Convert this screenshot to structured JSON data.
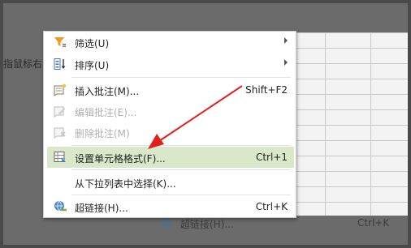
{
  "background": {
    "hint_text": "指鼠标右",
    "ghost_row": {
      "label": "超链接(H)...",
      "shortcut": "Ctrl+K"
    }
  },
  "context_menu": {
    "items": [
      {
        "label": "筛选(U)",
        "icon": "filter-icon",
        "submenu": true,
        "state": "normal"
      },
      {
        "label": "排序(U)",
        "icon": "sort-icon",
        "submenu": true,
        "state": "normal"
      },
      {
        "label": "插入批注(M)...",
        "shortcut": "Shift+F2",
        "icon": "insert-comment-icon",
        "state": "normal"
      },
      {
        "label": "编辑批注(E)...",
        "icon": "edit-comment-icon",
        "state": "disabled"
      },
      {
        "label": "删除批注(M)",
        "icon": "delete-comment-icon",
        "state": "disabled"
      },
      {
        "label": "设置单元格格式(F)...",
        "shortcut": "Ctrl+1",
        "icon": "format-cells-icon",
        "state": "highlighted"
      },
      {
        "label": "从下拉列表中选择(K)...",
        "state": "normal"
      },
      {
        "label": "超链接(H)...",
        "shortcut": "Ctrl+K",
        "icon": "hyperlink-icon",
        "state": "normal"
      }
    ]
  },
  "annotation": {
    "arrow_color": "#e02020"
  },
  "colors": {
    "highlight": "#d8e8c8",
    "disabled_text": "#b0b0b0"
  }
}
